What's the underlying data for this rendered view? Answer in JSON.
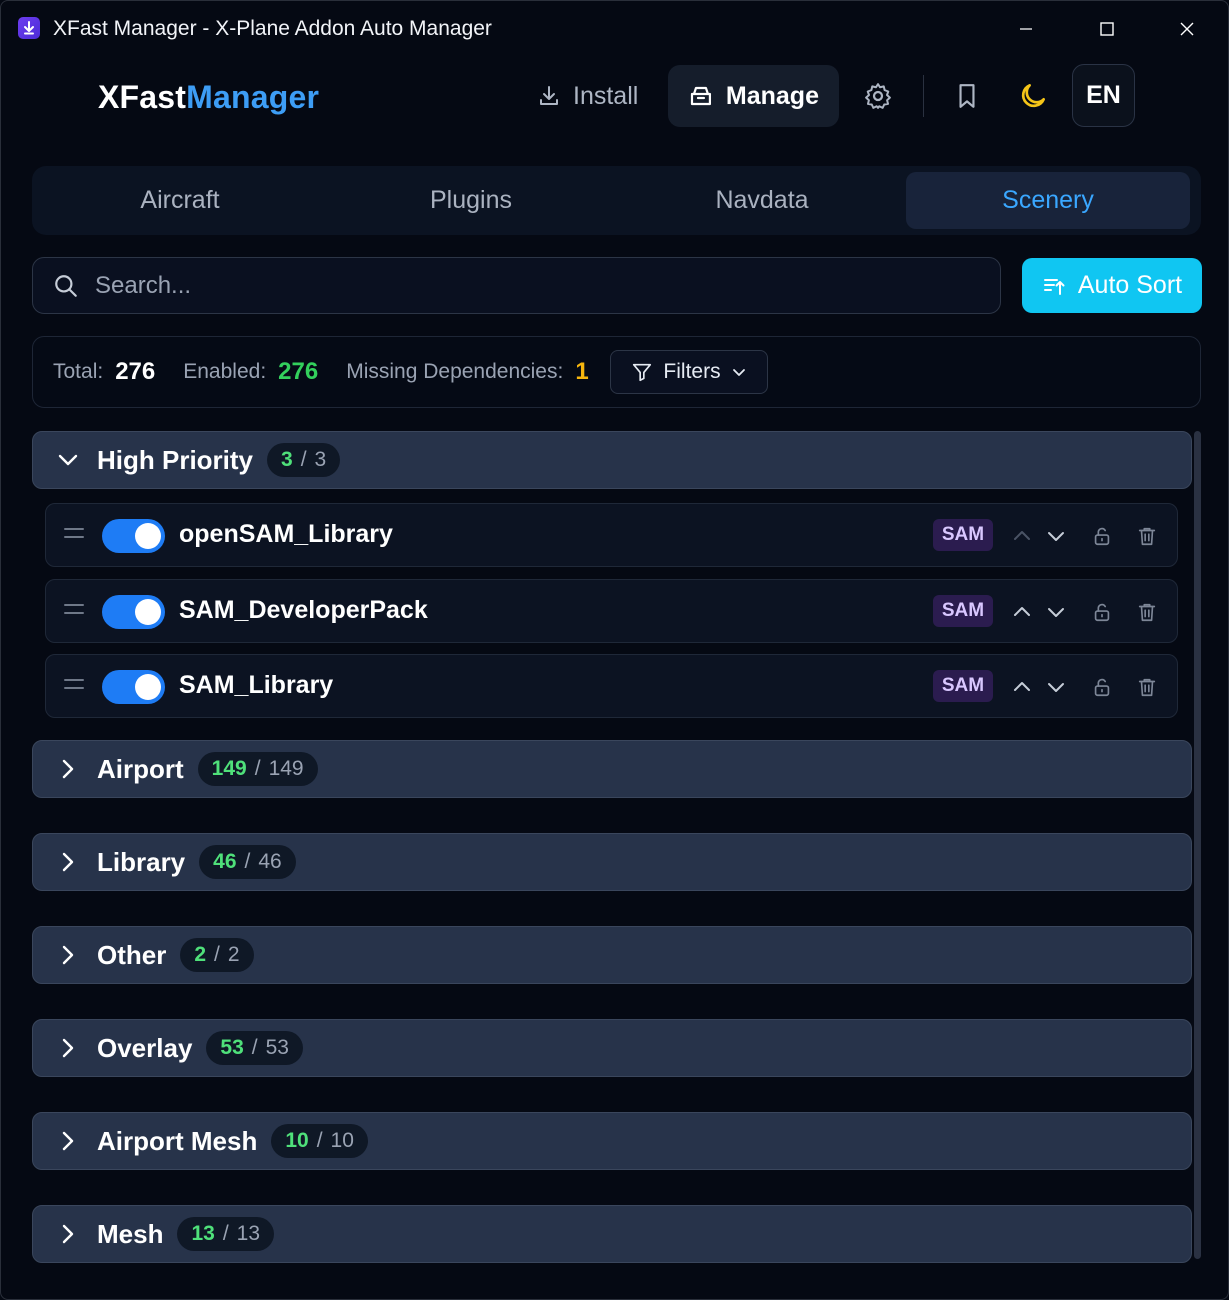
{
  "window": {
    "title": "XFast Manager - X-Plane Addon Auto Manager"
  },
  "header": {
    "brand_part1": "XFast",
    "brand_part2": "Manager",
    "install_label": "Install",
    "manage_label": "Manage",
    "language": "EN"
  },
  "tabs": [
    {
      "label": "Aircraft"
    },
    {
      "label": "Plugins"
    },
    {
      "label": "Navdata"
    },
    {
      "label": "Scenery",
      "active": true
    }
  ],
  "search": {
    "placeholder": "Search...",
    "value": ""
  },
  "autosort": {
    "label": "Auto Sort"
  },
  "stats": {
    "total_label": "Total:",
    "total_value": "276",
    "enabled_label": "Enabled:",
    "enabled_value": "276",
    "missing_label": "Missing Dependencies:",
    "missing_value": "1",
    "filters_label": "Filters"
  },
  "groups": [
    {
      "name": "High Priority",
      "enabled": "3",
      "total": "3",
      "expanded": true
    },
    {
      "name": "Airport",
      "enabled": "149",
      "total": "149",
      "expanded": false
    },
    {
      "name": "Library",
      "enabled": "46",
      "total": "46",
      "expanded": false
    },
    {
      "name": "Other",
      "enabled": "2",
      "total": "2",
      "expanded": false
    },
    {
      "name": "Overlay",
      "enabled": "53",
      "total": "53",
      "expanded": false
    },
    {
      "name": "Airport Mesh",
      "enabled": "10",
      "total": "10",
      "expanded": false
    },
    {
      "name": "Mesh",
      "enabled": "13",
      "total": "13",
      "expanded": false
    }
  ],
  "high_priority_items": [
    {
      "name": "openSAM_Library",
      "badge": "SAM",
      "enabled": true
    },
    {
      "name": "SAM_DeveloperPack",
      "badge": "SAM",
      "enabled": true
    },
    {
      "name": "SAM_Library",
      "badge": "SAM",
      "enabled": true
    }
  ],
  "colors": {
    "accent": "#3d9df5",
    "autosort": "#10c6f2",
    "toggle_on": "#1e7cf5",
    "enabled_count": "#4fe07a",
    "missing": "#f5b50e",
    "moon": "#f5c518"
  },
  "icons": {
    "install": "download-icon",
    "manage": "box-icon",
    "settings": "gear-icon",
    "bookmark": "bookmark-icon",
    "theme": "moon-icon",
    "search": "search-icon",
    "autosort": "sort-icon",
    "filters": "filter-icon"
  }
}
